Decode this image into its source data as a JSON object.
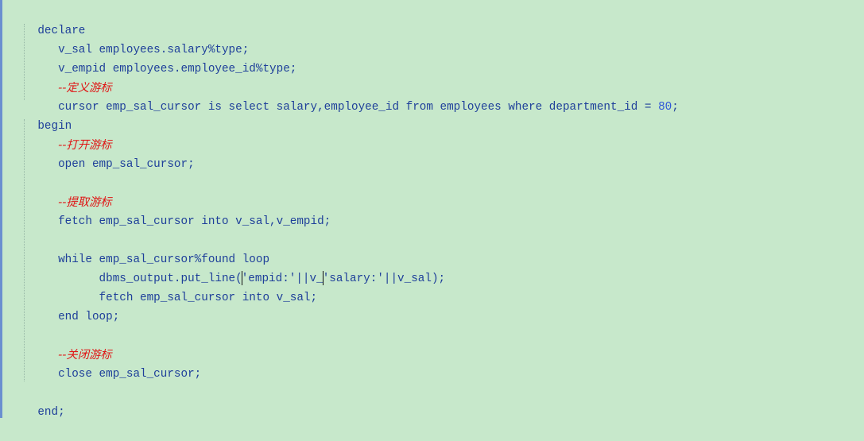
{
  "code": {
    "line_01": "declare",
    "line_02": "   v_sal employees.salary%type;",
    "line_03": "   v_empid employees.employee_id%type;",
    "line_04_prefix": "   ",
    "line_04_comment": "--定义游标",
    "line_05_text": "   cursor emp_sal_cursor is select salary,employee_id from employees where department_id = ",
    "line_05_number": "80",
    "line_05_end": ";",
    "line_06": "begin",
    "line_07_prefix": "   ",
    "line_07_comment": "--打开游标",
    "line_08": "   open emp_sal_cursor;",
    "line_09": "",
    "line_10_prefix": "   ",
    "line_10_comment": "--提取游标",
    "line_11": "   fetch emp_sal_cursor into v_sal,v_empid;",
    "line_12": "",
    "line_13": "   while emp_sal_cursor%found loop",
    "line_14_before": "         dbms_output.put_line(",
    "line_14_after": "'empid:'||v_",
    "line_14_tail": "'salary:'||v_sal);",
    "line_15": "         fetch emp_sal_cursor into v_sal;",
    "line_16": "   end loop;",
    "line_17": "",
    "line_18_prefix": "   ",
    "line_18_comment": "--关闭游标",
    "line_19": "   close emp_sal_cursor;",
    "line_20": "",
    "line_21": "end;"
  }
}
